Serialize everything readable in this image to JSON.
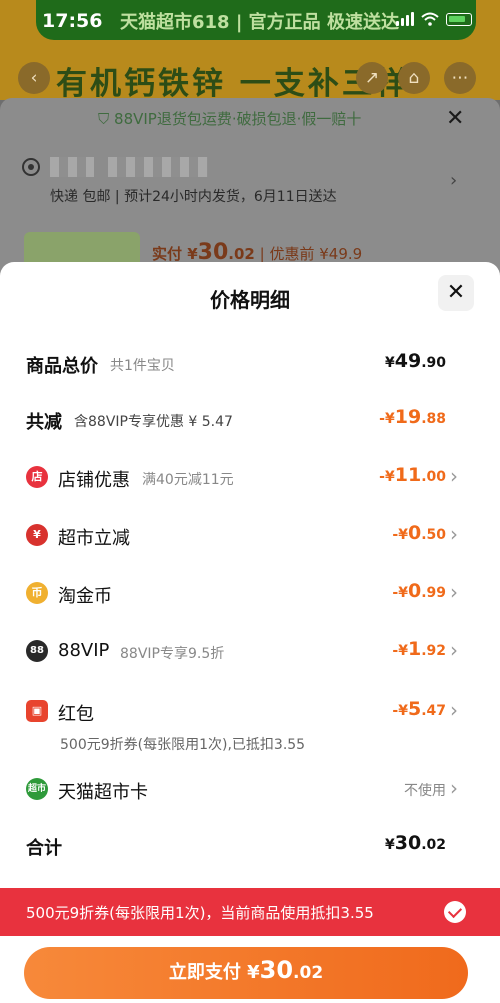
{
  "status_bar": {
    "time": "17:56"
  },
  "background": {
    "banner_strip_text": "天猫超市618 | 官方正品 极速送达",
    "product_title": "有机钙铁锌 一支补三样",
    "guarantee": "88VIP退货包运费·破损包退·假一赔十",
    "close_glyph": "✕",
    "shipping": "快递 包邮 | 预计24小时内发货，6月11日送达",
    "pay_prefix": "实付 ¥",
    "pay_big": "30",
    "pay_small": ".02",
    "pay_suffix": " | 优惠前 ¥49.9"
  },
  "sheet": {
    "title": "价格明细",
    "close_glyph": "✕",
    "total_price": {
      "label": "商品总价",
      "sub": "共1件宝贝",
      "prefix": "¥",
      "big": "49",
      "small": ".90"
    },
    "total_discount": {
      "label": "共减",
      "sub": "含88VIP专享优惠 ¥ 5.47",
      "prefix": "-¥",
      "big": "19",
      "small": ".88"
    },
    "discounts": [
      {
        "label": "店铺优惠",
        "sub": "满40元减11元",
        "prefix": "-¥",
        "big": "11",
        "small": ".00",
        "icon": "store-icon",
        "color": "#e8323e",
        "glyph": "店"
      },
      {
        "label": "超市立减",
        "sub": "",
        "prefix": "-¥",
        "big": "0",
        "small": ".50",
        "icon": "yen-icon",
        "color": "#d8322e",
        "glyph": "¥"
      },
      {
        "label": "淘金币",
        "sub": "",
        "prefix": "-¥",
        "big": "0",
        "small": ".99",
        "icon": "coin-icon",
        "color": "#f0b030",
        "glyph": "币"
      },
      {
        "label": "88VIP",
        "sub": "88VIP专享9.5折",
        "prefix": "-¥",
        "big": "1",
        "small": ".92",
        "icon": "vip-icon",
        "color": "#2a2a2a",
        "glyph": "88"
      },
      {
        "label": "红包",
        "sub": "",
        "prefix": "-¥",
        "big": "5",
        "small": ".47",
        "icon": "red-envelope-icon",
        "color": "#e8442e",
        "glyph": "▣"
      }
    ],
    "red_packet_detail": "500元9折券(每张限用1次),已抵扣3.55",
    "supermarket_card": {
      "label": "天猫超市卡",
      "value": "不使用",
      "icon": "supermarket-card-icon",
      "color": "#2e9a3a",
      "glyph": "超市"
    },
    "sum": {
      "label": "合计",
      "prefix": "¥",
      "big": "30",
      "small": ".02"
    }
  },
  "coupon_bar": {
    "text": "500元9折券(每张限用1次)，当前商品使用抵扣3.55"
  },
  "pay_button": {
    "label": "立即支付 ¥",
    "big": "30",
    "small": ".02"
  },
  "colors": {
    "accent": "#f06a1a",
    "coupon_red": "#e8323e"
  }
}
